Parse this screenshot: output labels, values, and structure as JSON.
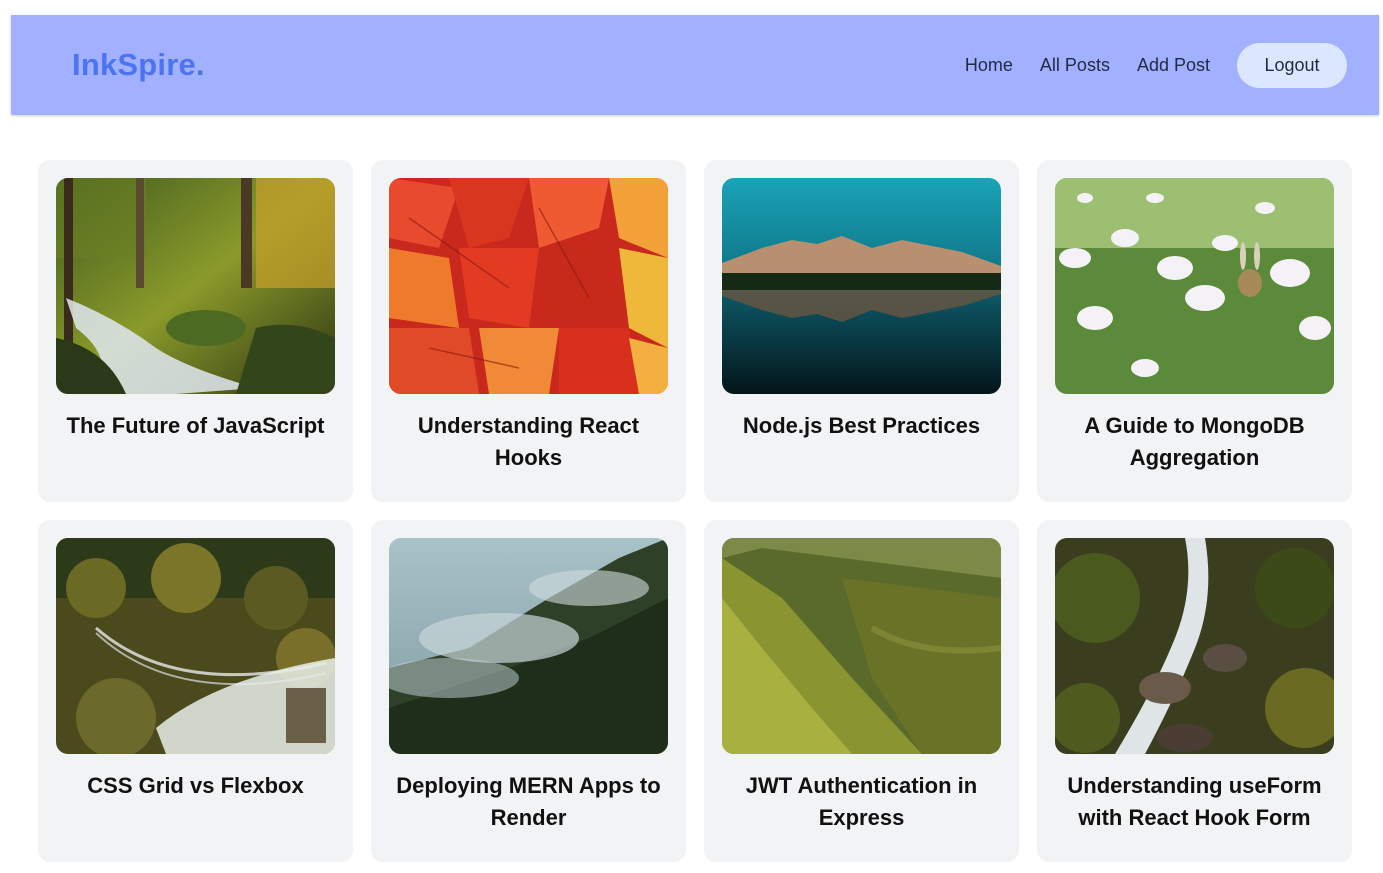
{
  "header": {
    "logo": "InkSpire.",
    "nav": {
      "home": "Home",
      "all_posts": "All Posts",
      "add_post": "Add Post",
      "logout": "Logout"
    }
  },
  "posts": [
    {
      "title": "The Future of JavaScript",
      "image": "forest-waterfall-image"
    },
    {
      "title": "Understanding React Hooks",
      "image": "autumn-leaves-image"
    },
    {
      "title": "Node.js Best Practices",
      "image": "mountain-lake-image"
    },
    {
      "title": "A Guide to MongoDB Aggregation",
      "image": "white-flowers-image"
    },
    {
      "title": "CSS Grid vs Flexbox",
      "image": "suspension-bridge-image"
    },
    {
      "title": "Deploying MERN Apps to Render",
      "image": "misty-forest-image"
    },
    {
      "title": "JWT Authentication in Express",
      "image": "green-valley-image"
    },
    {
      "title": "Understanding useForm with React Hook Form",
      "image": "rocky-waterfall-image"
    }
  ],
  "colors": {
    "header_bg": "#a2b1ff",
    "logo": "#4d74f0",
    "logout_bg": "#dbe6ff",
    "card_bg": "#f2f3f5"
  }
}
